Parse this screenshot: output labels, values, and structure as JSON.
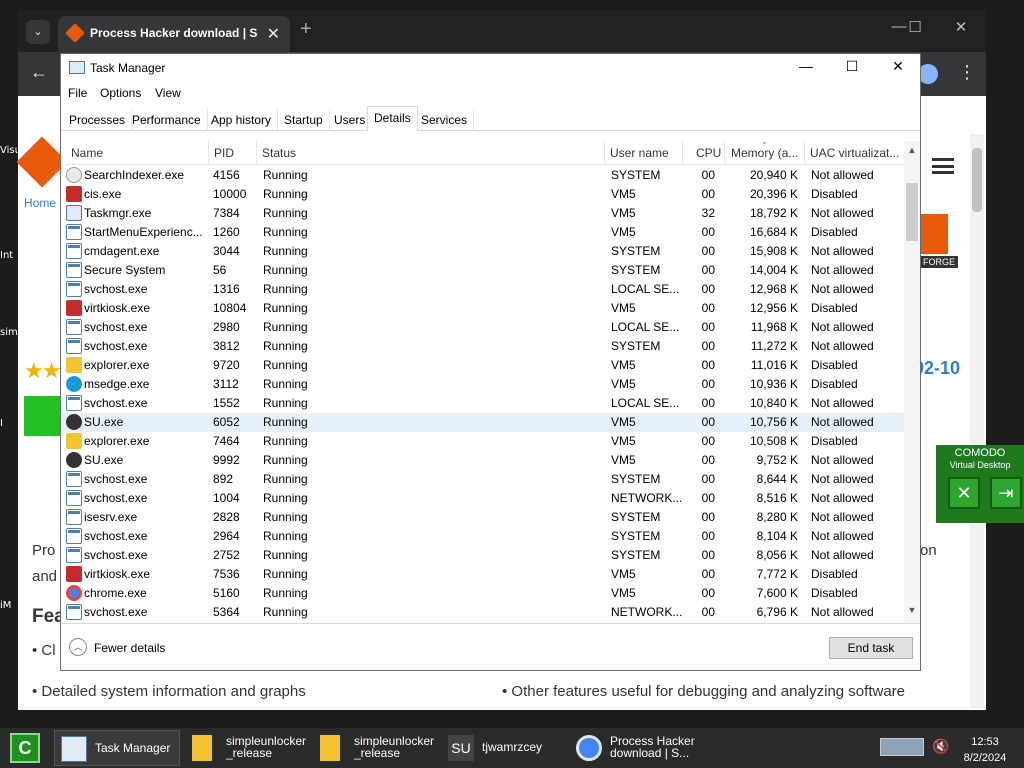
{
  "desktop": {
    "labels": [
      "Visu",
      "Int",
      "simp",
      "I",
      "iM"
    ]
  },
  "browser": {
    "tab_title": "Process Hacker download | Sc",
    "new_tab": "+",
    "tablist": "⌄",
    "close": "✕",
    "back": "←",
    "menu": "⋮",
    "minimize": "—",
    "maximize": "☐",
    "win_close": "✕",
    "page": {
      "home_link": "Home",
      "stars": "★★",
      "date_fragment": "02-10",
      "badge_fragment": "FORGE",
      "text_lines": [
        "Pro",
        "and",
        "Fea",
        "• Cl",
        "on",
        "• Detailed system information and graphs",
        "• Other features useful for debugging and analyzing software"
      ]
    }
  },
  "comodo": {
    "title": "COMODO",
    "subtitle": "Virtual Desktop",
    "close_btn": "✕",
    "exit_btn": "⇥"
  },
  "taskmgr": {
    "title": "Task Manager",
    "controls": {
      "minimize": "—",
      "maximize": "☐",
      "close": "✕"
    },
    "menu": [
      "File",
      "Options",
      "View"
    ],
    "tabs": [
      "Processes",
      "Performance",
      "App history",
      "Startup",
      "Users",
      "Details",
      "Services"
    ],
    "active_tab": "Details",
    "columns": [
      "Name",
      "PID",
      "Status",
      "User name",
      "CPU",
      "Memory (a...",
      "UAC virtualizat..."
    ],
    "rows": [
      {
        "icon": "search",
        "name": "SearchIndexer.exe",
        "pid": "4156",
        "status": "Running",
        "user": "SYSTEM",
        "cpu": "00",
        "mem": "20,940 K",
        "uac": "Not allowed"
      },
      {
        "icon": "red",
        "name": "cis.exe",
        "pid": "10000",
        "status": "Running",
        "user": "VM5",
        "cpu": "00",
        "mem": "20,396 K",
        "uac": "Disabled"
      },
      {
        "icon": "taskmgr",
        "name": "Taskmgr.exe",
        "pid": "7384",
        "status": "Running",
        "user": "VM5",
        "cpu": "32",
        "mem": "18,792 K",
        "uac": "Not allowed"
      },
      {
        "icon": "win",
        "name": "StartMenuExperienc...",
        "pid": "1260",
        "status": "Running",
        "user": "VM5",
        "cpu": "00",
        "mem": "16,684 K",
        "uac": "Disabled"
      },
      {
        "icon": "win",
        "name": "cmdagent.exe",
        "pid": "3044",
        "status": "Running",
        "user": "SYSTEM",
        "cpu": "00",
        "mem": "15,908 K",
        "uac": "Not allowed"
      },
      {
        "icon": "win",
        "name": "Secure System",
        "pid": "56",
        "status": "Running",
        "user": "SYSTEM",
        "cpu": "00",
        "mem": "14,004 K",
        "uac": "Not allowed"
      },
      {
        "icon": "win",
        "name": "svchost.exe",
        "pid": "1316",
        "status": "Running",
        "user": "LOCAL SE...",
        "cpu": "00",
        "mem": "12,968 K",
        "uac": "Not allowed"
      },
      {
        "icon": "red",
        "name": "virtkiosk.exe",
        "pid": "10804",
        "status": "Running",
        "user": "VM5",
        "cpu": "00",
        "mem": "12,956 K",
        "uac": "Disabled"
      },
      {
        "icon": "win",
        "name": "svchost.exe",
        "pid": "2980",
        "status": "Running",
        "user": "LOCAL SE...",
        "cpu": "00",
        "mem": "11,968 K",
        "uac": "Not allowed"
      },
      {
        "icon": "win",
        "name": "svchost.exe",
        "pid": "3812",
        "status": "Running",
        "user": "SYSTEM",
        "cpu": "00",
        "mem": "11,272 K",
        "uac": "Not allowed"
      },
      {
        "icon": "folder",
        "name": "explorer.exe",
        "pid": "9720",
        "status": "Running",
        "user": "VM5",
        "cpu": "00",
        "mem": "11,016 K",
        "uac": "Disabled"
      },
      {
        "icon": "edge",
        "name": "msedge.exe",
        "pid": "3112",
        "status": "Running",
        "user": "VM5",
        "cpu": "00",
        "mem": "10,936 K",
        "uac": "Disabled"
      },
      {
        "icon": "win",
        "name": "svchost.exe",
        "pid": "1552",
        "status": "Running",
        "user": "LOCAL SE...",
        "cpu": "00",
        "mem": "10,840 K",
        "uac": "Not allowed"
      },
      {
        "icon": "su",
        "name": "SU.exe",
        "pid": "6052",
        "status": "Running",
        "user": "VM5",
        "cpu": "00",
        "mem": "10,756 K",
        "uac": "Not allowed",
        "highlight": true
      },
      {
        "icon": "folder",
        "name": "explorer.exe",
        "pid": "7464",
        "status": "Running",
        "user": "VM5",
        "cpu": "00",
        "mem": "10,508 K",
        "uac": "Disabled"
      },
      {
        "icon": "su",
        "name": "SU.exe",
        "pid": "9992",
        "status": "Running",
        "user": "VM5",
        "cpu": "00",
        "mem": "9,752 K",
        "uac": "Not allowed"
      },
      {
        "icon": "win",
        "name": "svchost.exe",
        "pid": "892",
        "status": "Running",
        "user": "SYSTEM",
        "cpu": "00",
        "mem": "8,644 K",
        "uac": "Not allowed"
      },
      {
        "icon": "win",
        "name": "svchost.exe",
        "pid": "1004",
        "status": "Running",
        "user": "NETWORK...",
        "cpu": "00",
        "mem": "8,516 K",
        "uac": "Not allowed"
      },
      {
        "icon": "win",
        "name": "isesrv.exe",
        "pid": "2828",
        "status": "Running",
        "user": "SYSTEM",
        "cpu": "00",
        "mem": "8,280 K",
        "uac": "Not allowed"
      },
      {
        "icon": "win",
        "name": "svchost.exe",
        "pid": "2964",
        "status": "Running",
        "user": "SYSTEM",
        "cpu": "00",
        "mem": "8,104 K",
        "uac": "Not allowed"
      },
      {
        "icon": "win",
        "name": "svchost.exe",
        "pid": "2752",
        "status": "Running",
        "user": "SYSTEM",
        "cpu": "00",
        "mem": "8,056 K",
        "uac": "Not allowed"
      },
      {
        "icon": "red",
        "name": "virtkiosk.exe",
        "pid": "7536",
        "status": "Running",
        "user": "VM5",
        "cpu": "00",
        "mem": "7,772 K",
        "uac": "Disabled"
      },
      {
        "icon": "chrome",
        "name": "chrome.exe",
        "pid": "5160",
        "status": "Running",
        "user": "VM5",
        "cpu": "00",
        "mem": "7,600 K",
        "uac": "Disabled"
      },
      {
        "icon": "win",
        "name": "svchost.exe",
        "pid": "5364",
        "status": "Running",
        "user": "NETWORK...",
        "cpu": "00",
        "mem": "6,796 K",
        "uac": "Not allowed"
      }
    ],
    "fewer_details": "Fewer details",
    "end_task": "End task"
  },
  "taskbar": {
    "start": "C",
    "buttons": [
      {
        "label": "Task Manager",
        "active": true
      },
      {
        "label": "simpleunlocker\n_release",
        "active": false
      },
      {
        "label": "simpleunlocker\n_release",
        "active": false
      },
      {
        "label": "tjwamrzcey",
        "active": false
      },
      {
        "label": "Process Hacker\ndownload | S...",
        "active": false
      }
    ],
    "su_text": "SU",
    "time": "12:53",
    "date": "8/2/2024"
  }
}
